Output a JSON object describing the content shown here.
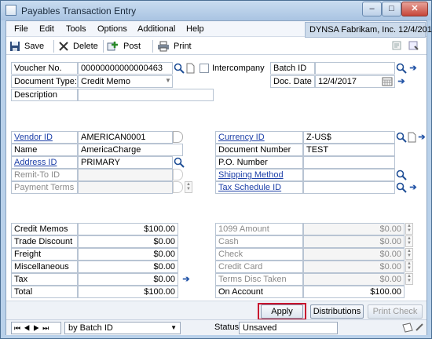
{
  "window": {
    "title": "Payables Transaction Entry"
  },
  "menu": [
    "File",
    "Edit",
    "Tools",
    "Options",
    "Additional",
    "Help"
  ],
  "company": "DYNSA  Fabrikam, Inc. 12/4/2017",
  "toolbar": {
    "save": "Save",
    "delete": "Delete",
    "post": "Post",
    "print": "Print"
  },
  "header": {
    "voucher_label": "Voucher No.",
    "voucher_value": "00000000000000463",
    "intercompany_label": "Intercompany",
    "doc_type_label": "Document Type:",
    "doc_type_value": "Credit  Memo",
    "description_label": "Description",
    "batch_label": "Batch ID",
    "doc_date_label": "Doc. Date",
    "doc_date_value": "12/4/2017"
  },
  "vendor": {
    "vendor_id_label": "Vendor ID",
    "vendor_id_value": "AMERICAN0001",
    "name_label": "Name",
    "name_value": "AmericaCharge",
    "address_label": "Address ID",
    "address_value": "PRIMARY",
    "remit_label": "Remit-To ID",
    "payment_terms_label": "Payment Terms"
  },
  "doc": {
    "currency_label": "Currency ID",
    "currency_value": "Z-US$",
    "docnum_label": "Document Number",
    "docnum_value": "TEST",
    "po_label": "P.O. Number",
    "shipping_label": "Shipping Method",
    "tax_schedule_label": "Tax Schedule ID"
  },
  "amounts_left": [
    {
      "label": "Credit Memos",
      "value": "$100.00"
    },
    {
      "label": "Trade Discount",
      "value": "$0.00"
    },
    {
      "label": "Freight",
      "value": "$0.00"
    },
    {
      "label": "Miscellaneous",
      "value": "$0.00"
    },
    {
      "label": "Tax",
      "value": "$0.00"
    },
    {
      "label": "Total",
      "value": "$100.00"
    }
  ],
  "amounts_right": [
    {
      "label": "1099 Amount",
      "value": "$0.00"
    },
    {
      "label": "Cash",
      "value": "$0.00"
    },
    {
      "label": "Check",
      "value": "$0.00"
    },
    {
      "label": "Credit Card",
      "value": "$0.00"
    },
    {
      "label": "Terms Disc Taken",
      "value": "$0.00"
    },
    {
      "label": "On Account",
      "value": "$100.00"
    }
  ],
  "buttons": {
    "apply": "Apply",
    "distributions": "Distributions",
    "print_check": "Print Check"
  },
  "status": {
    "browse_by": "by Batch ID",
    "status_label": "Status",
    "status_value": "Unsaved"
  },
  "colors": {
    "highlight": "#c8102e",
    "link": "#1c3fa8"
  }
}
